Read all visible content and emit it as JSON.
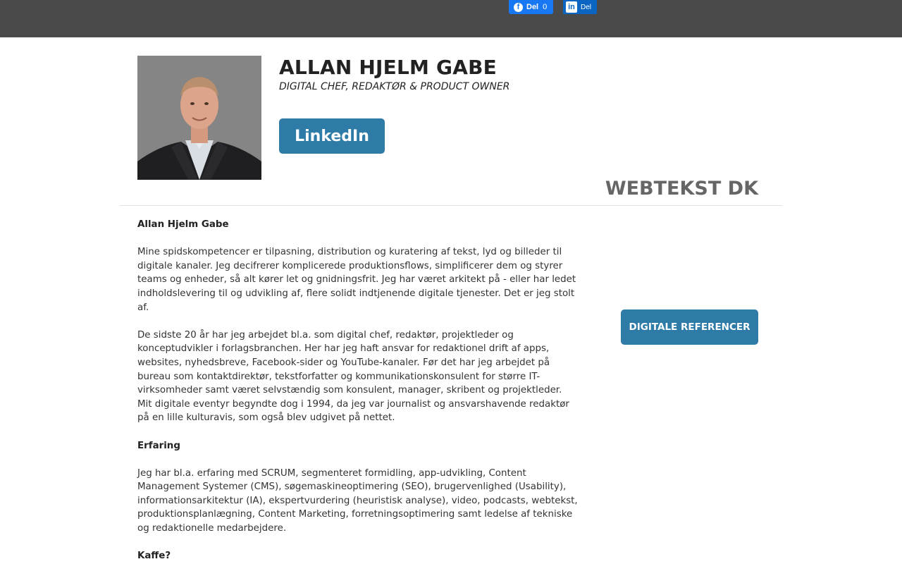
{
  "header": {
    "facebook_share": {
      "label": "Del",
      "count": "0",
      "icon": "facebook-icon"
    },
    "linkedin_share": {
      "label": "Del",
      "icon": "linkedin-icon"
    }
  },
  "profile": {
    "name": "ALLAN HJELM GABE",
    "title": "DIGITAL CHEF, REDAKTØR & PRODUCT OWNER",
    "linkedin_button": "LinkedIn",
    "brand": "WEBTEKST DK"
  },
  "body": {
    "heading_name": "Allan Hjelm Gabe",
    "para1": "Mine spidskompetencer er tilpasning, distribution og kuratering af tekst, lyd og billeder til digitale kanaler. Jeg decifrerer komplicerede produktionsflows, simplificerer dem og styrer teams og enheder, så alt kører let og gnidningsfrit. Jeg har været arkitekt på - eller har ledet indholdslevering til og udvikling af, flere solidt indtjenende digitale tjenester. Det er jeg stolt af.",
    "para2": "De sidste 20 år har jeg arbejdet bl.a. som digital chef, redaktør, projektleder og konceptudvikler i forlagsbranchen. Her har jeg haft ansvar for redaktionel drift af apps, websites, nyhedsbreve, Facebook-sider og YouTube-kanaler. Før det har jeg arbejdet på bureau som kontaktdirektør, tekstforfatter og kommunikationskonsulent for større IT-virksomheder samt været selvstændig som konsulent, manager, skribent og projektleder. Mit digitale eventyr begyndte dog i 1994, da jeg var journalist og ansvarshavende redaktør på en lille kulturavis, som også blev udgivet på nettet.",
    "heading_experience": "Erfaring",
    "para3": "Jeg har bl.a. erfaring med SCRUM, segmenteret formidling, app-udvikling, Content Management Systemer (CMS), søgemaskineoptimering (SEO), brugervenlighed (Usability), informationsarkitektur (IA), ekspertvurdering (heuristisk analyse), video, podcasts, webtekst, produktionsplanlægning, Content Marketing, forretningsoptimering samt ledelse af tekniske og redaktionelle medarbejdere.",
    "heading_coffee": "Kaffe?"
  },
  "sidebar": {
    "references_button": "DIGITALE REFERENCER"
  },
  "colors": {
    "topbar": "#4a4a4a",
    "button": "#2e7ba8",
    "facebook": "#1877f2",
    "linkedin": "#0a66c2"
  }
}
